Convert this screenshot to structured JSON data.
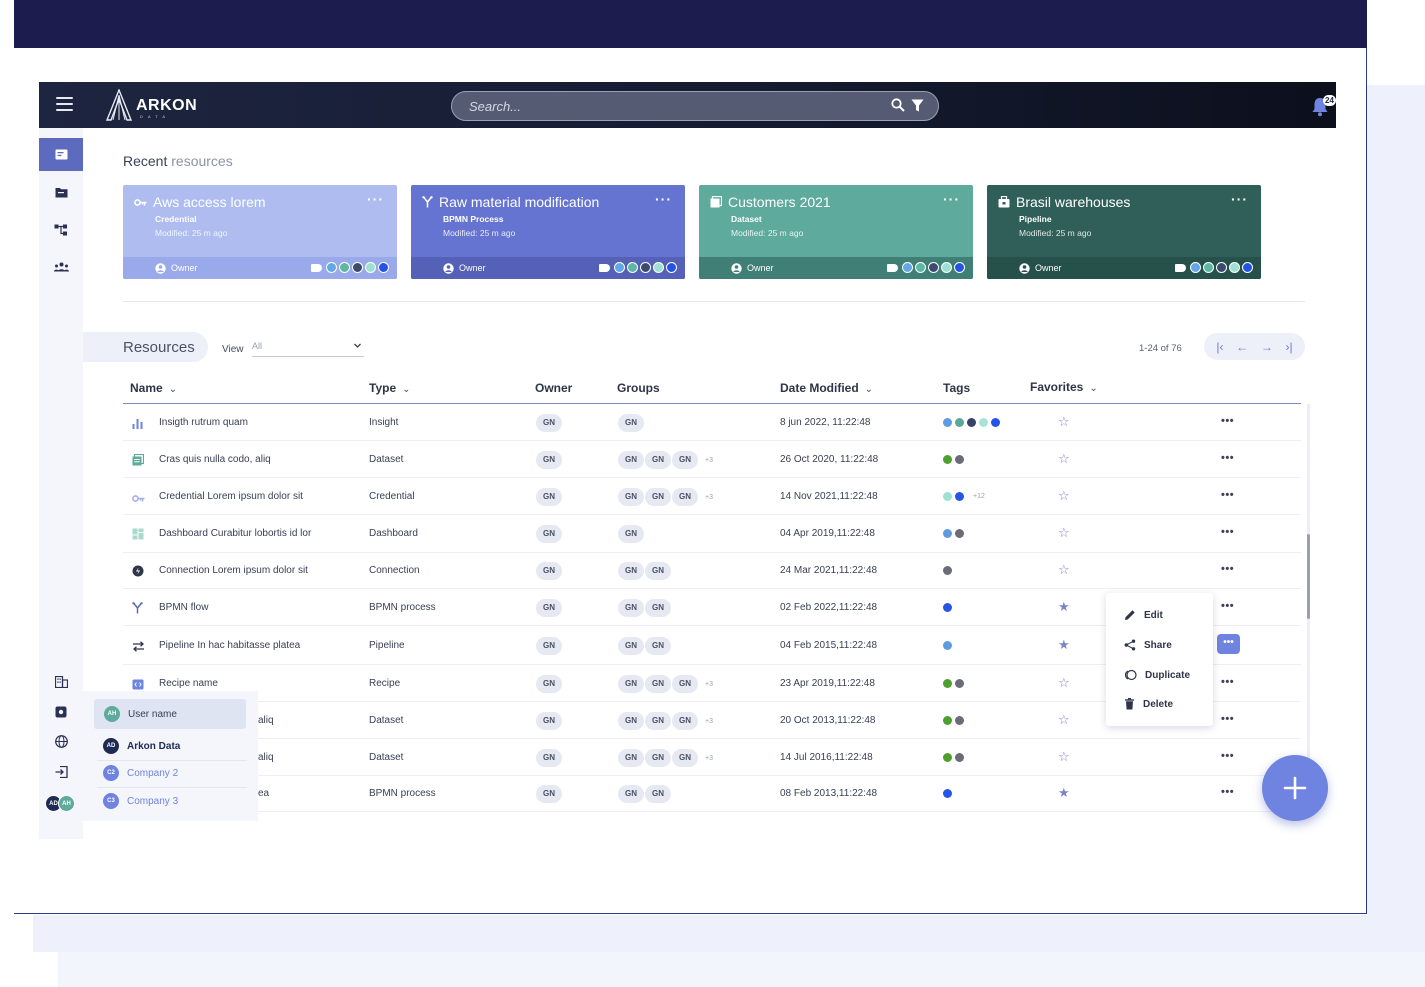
{
  "app": {
    "logo_text": "ARKON",
    "logo_sub": "DATA"
  },
  "search": {
    "placeholder": "Search..."
  },
  "notifications": {
    "count": "24"
  },
  "recent": {
    "title": "Recent",
    "title_light": "resources",
    "cards": [
      {
        "title": "Aws access lorem",
        "type": "Credential",
        "modified": "Modified: 25 m ago",
        "owner": "Owner",
        "color": "#aebcf0",
        "foot": "#9aa9ea",
        "icon": "key-icon"
      },
      {
        "title": "Raw material modification",
        "type": "BPMN Process",
        "modified": "Modified: 25 m ago",
        "owner": "Owner",
        "color": "#6674d1",
        "foot": "#5561b6",
        "icon": "bpmn-icon"
      },
      {
        "title": "Customers 2021",
        "type": "Dataset",
        "modified": "Modified: 25 m ago",
        "owner": "Owner",
        "color": "#5eaa9c",
        "foot": "#3f7f75",
        "icon": "dataset-icon"
      },
      {
        "title": "Brasil warehouses",
        "type": "Pipeline",
        "modified": "Modified: 25 m ago",
        "owner": "Owner",
        "color": "#2f5f58",
        "foot": "#26504a",
        "icon": "pipeline-icon"
      }
    ],
    "card_tag_colors": [
      "#62a7e6",
      "#5eb6a5",
      "#3d4a70",
      "#9fe0d2",
      "#2454e6"
    ]
  },
  "resources": {
    "tab_label": "Resources",
    "view_label": "View",
    "view_value": "All",
    "pager_label": "1-24 of 76",
    "columns": {
      "name": "Name",
      "type": "Type",
      "owner": "Owner",
      "groups": "Groups",
      "date": "Date Modified",
      "tags": "Tags",
      "favorites": "Favorites"
    },
    "rows": [
      {
        "name": "Insigth rutrum quam",
        "type": "Insight",
        "owner": "GN",
        "groups": [
          "GN"
        ],
        "more": "",
        "date": "8 jun 2022, 11:22:48",
        "tags": [
          "#5e9be2",
          "#5aa89a",
          "#364266",
          "#a9e3d8",
          "#2352e8"
        ],
        "fav": false,
        "icon": "insight-icon"
      },
      {
        "name": "Cras quis nulla codo, aliq",
        "type": "Dataset",
        "owner": "GN",
        "groups": [
          "GN",
          "GN",
          "GN"
        ],
        "more": "+3",
        "date": "26 Oct 2020, 11:22:48",
        "tags": [
          "#4d9f2e",
          "#6a6d78"
        ],
        "fav": false,
        "icon": "dataset-icon"
      },
      {
        "name": "Credential Lorem ipsum dolor sit",
        "type": "Credential",
        "owner": "GN",
        "groups": [
          "GN",
          "GN",
          "GN"
        ],
        "more": "+3",
        "date": "14 Nov 2021,11:22:48",
        "tags": [
          "#9fe0d4",
          "#2756e6"
        ],
        "tags_more": "+12",
        "fav": false,
        "icon": "key-icon"
      },
      {
        "name": "Dashboard Curabitur lobortis id lor",
        "type": "Dashboard",
        "owner": "GN",
        "groups": [
          "GN"
        ],
        "more": "",
        "date": "04 Apr 2019,11:22:48",
        "tags": [
          "#5e9be2",
          "#6a6d78"
        ],
        "fav": false,
        "icon": "dashboard-icon"
      },
      {
        "name": "Connection Lorem ipsum dolor sit",
        "type": "Connection",
        "owner": "GN",
        "groups": [
          "GN",
          "GN"
        ],
        "more": "",
        "date": "24 Mar 2021,11:22:48",
        "tags": [
          "#6a6d78"
        ],
        "fav": false,
        "icon": "connection-icon"
      },
      {
        "name": "BPMN flow",
        "type": "BPMN process",
        "owner": "GN",
        "groups": [
          "GN",
          "GN"
        ],
        "more": "",
        "date": "02 Feb 2022,11:22:48",
        "tags": [
          "#2756e6"
        ],
        "fav": true,
        "icon": "bpmn-icon"
      },
      {
        "name": "Pipeline In hac habitasse platea",
        "type": "Pipeline",
        "owner": "GN",
        "groups": [
          "GN",
          "GN"
        ],
        "more": "",
        "date": "04 Feb 2015,11:22:48",
        "tags": [
          "#5e9be2"
        ],
        "fav": true,
        "icon": "pipeline-icon"
      },
      {
        "name": "Recipe name",
        "type": "Recipe",
        "owner": "GN",
        "groups": [
          "GN",
          "GN",
          "GN"
        ],
        "more": "+3",
        "date": "23 Apr 2019,11:22:48",
        "tags": [
          "#4d9f2e",
          "#6a6d78"
        ],
        "fav": false,
        "icon": "recipe-icon"
      },
      {
        "name": "aliq",
        "type": "Dataset",
        "owner": "GN",
        "groups": [
          "GN",
          "GN",
          "GN"
        ],
        "more": "+3",
        "date": "20 Oct 2013,11:22:48",
        "tags": [
          "#4d9f2e",
          "#6a6d78"
        ],
        "fav": false,
        "icon": ""
      },
      {
        "name": "aliq",
        "type": "Dataset",
        "owner": "GN",
        "groups": [
          "GN",
          "GN",
          "GN"
        ],
        "more": "+3",
        "date": "14 Jul 2016,11:22:48",
        "tags": [
          "#4d9f2e",
          "#6a6d78"
        ],
        "fav": false,
        "icon": ""
      },
      {
        "name": "ea",
        "type": "BPMN process",
        "owner": "GN",
        "groups": [
          "GN",
          "GN"
        ],
        "more": "",
        "date": "08 Feb 2013,11:22:48",
        "tags": [
          "#2756e6"
        ],
        "fav": true,
        "icon": ""
      }
    ]
  },
  "context_menu": {
    "edit": "Edit",
    "share": "Share",
    "duplicate": "Duplicate",
    "delete": "Delete"
  },
  "switcher": {
    "user": {
      "initials": "AH",
      "label": "User name"
    },
    "companies": [
      {
        "initials": "AD",
        "label": "Arkon Data",
        "active": true,
        "color": "#1f2a55"
      },
      {
        "initials": "C2",
        "label": "Company 2",
        "active": false,
        "color": "#6f83e0"
      },
      {
        "initials": "C3",
        "label": "Company 3",
        "active": false,
        "color": "#6f83e0"
      }
    ]
  },
  "sidebar_avatars": [
    {
      "initials": "AD",
      "color": "#1f2a55"
    },
    {
      "initials": "AH",
      "color": "#5eaa9c"
    }
  ]
}
